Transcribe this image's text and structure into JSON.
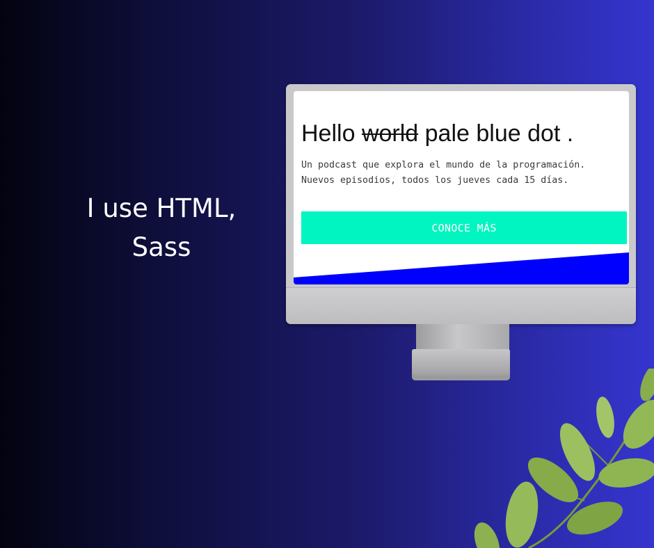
{
  "tagline": {
    "line1": "I use HTML,",
    "line2": "Sass"
  },
  "monitor": {
    "headline": {
      "hello": "Hello ",
      "struck": "world",
      "rest": " pale blue dot ."
    },
    "description": {
      "line1": "Un podcast que explora el mundo de la programación.",
      "line2": "Nuevos episodios, todos los jueves cada 15 días."
    },
    "cta_label": "CONOCE MÁS"
  },
  "colors": {
    "accent": "#00f5c0",
    "wedge": "#0000ff"
  },
  "decorations": [
    "monitor-illustration",
    "leaf-branch"
  ]
}
